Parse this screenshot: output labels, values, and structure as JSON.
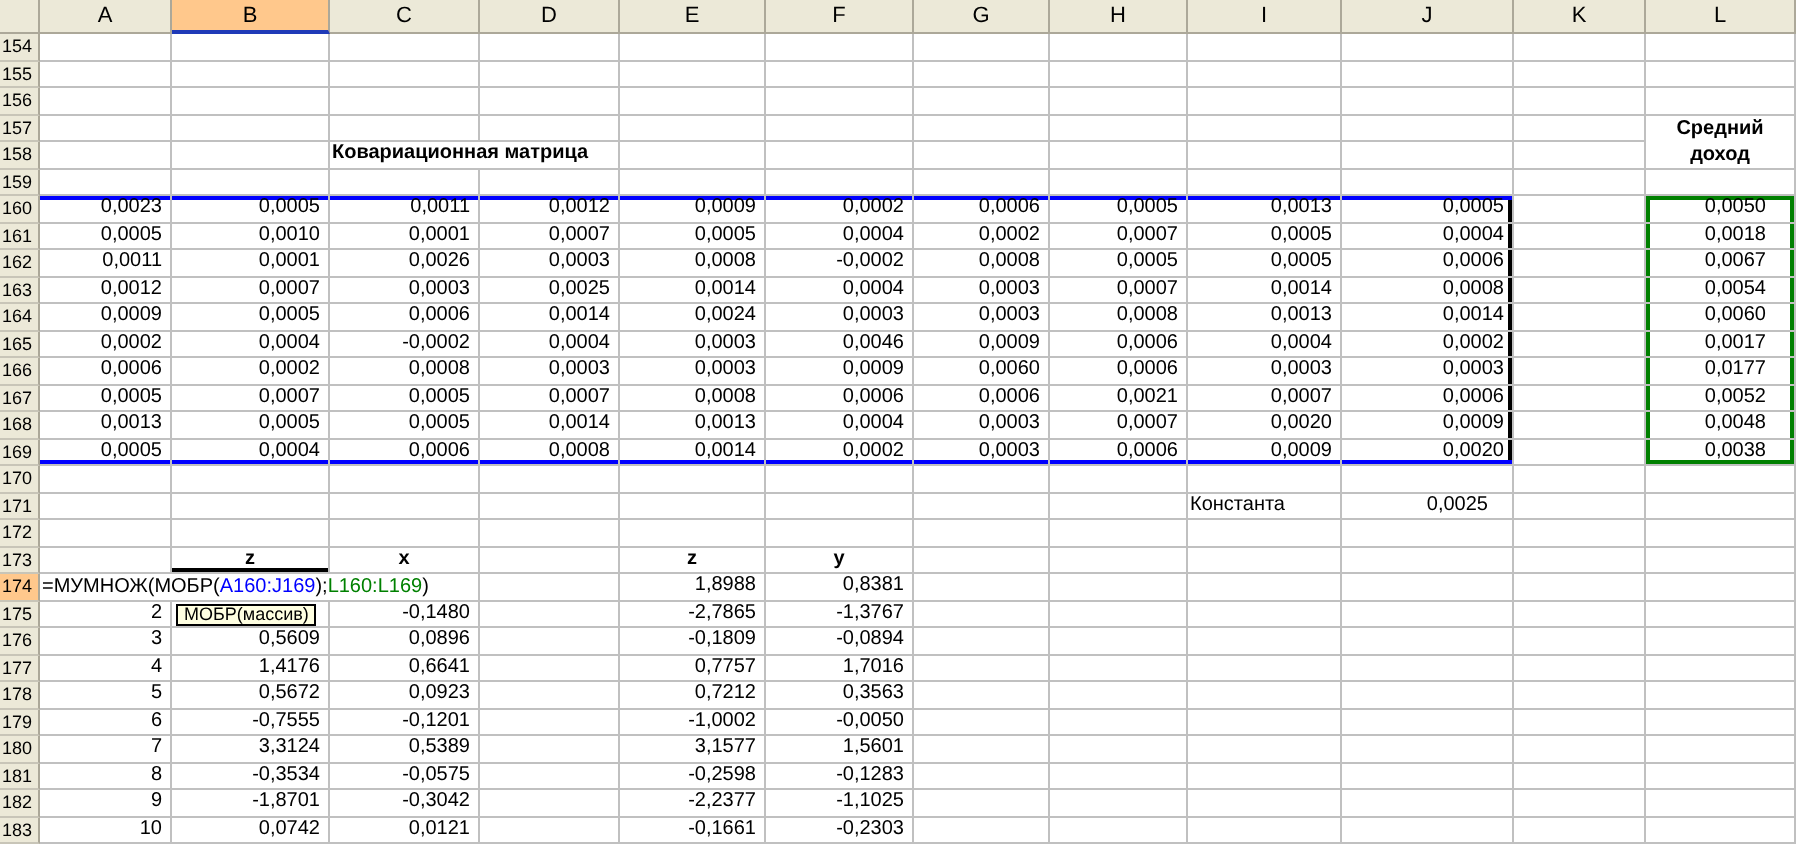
{
  "columns": [
    {
      "label": "A",
      "selected": false
    },
    {
      "label": "B",
      "selected": true
    },
    {
      "label": "C",
      "selected": false
    },
    {
      "label": "D",
      "selected": false
    },
    {
      "label": "E",
      "selected": false
    },
    {
      "label": "F",
      "selected": false
    },
    {
      "label": "G",
      "selected": false
    },
    {
      "label": "H",
      "selected": false
    },
    {
      "label": "I",
      "selected": false
    },
    {
      "label": "J",
      "selected": false
    },
    {
      "label": "K",
      "selected": false
    },
    {
      "label": "L",
      "selected": false
    }
  ],
  "rows": [
    {
      "number": "154",
      "selected": false
    },
    {
      "number": "155",
      "selected": false
    },
    {
      "number": "156",
      "selected": false
    },
    {
      "number": "157",
      "selected": false
    },
    {
      "number": "158",
      "selected": false
    },
    {
      "number": "159",
      "selected": false
    },
    {
      "number": "160",
      "selected": false
    },
    {
      "number": "161",
      "selected": false
    },
    {
      "number": "162",
      "selected": false
    },
    {
      "number": "163",
      "selected": false
    },
    {
      "number": "164",
      "selected": false
    },
    {
      "number": "165",
      "selected": false
    },
    {
      "number": "166",
      "selected": false
    },
    {
      "number": "167",
      "selected": false
    },
    {
      "number": "168",
      "selected": false
    },
    {
      "number": "169",
      "selected": false
    },
    {
      "number": "170",
      "selected": false
    },
    {
      "number": "171",
      "selected": false
    },
    {
      "number": "172",
      "selected": false
    },
    {
      "number": "173",
      "selected": false
    },
    {
      "number": "174",
      "selected": true
    },
    {
      "number": "175",
      "selected": false
    },
    {
      "number": "176",
      "selected": false
    },
    {
      "number": "177",
      "selected": false
    },
    {
      "number": "178",
      "selected": false
    },
    {
      "number": "179",
      "selected": false
    },
    {
      "number": "180",
      "selected": false
    },
    {
      "number": "181",
      "selected": false
    },
    {
      "number": "182",
      "selected": false
    },
    {
      "number": "183",
      "selected": false
    }
  ],
  "matrix_title": "Ковариационная матрица",
  "matrix": [
    [
      "0,0023",
      "0,0005",
      "0,0011",
      "0,0012",
      "0,0009",
      "0,0002",
      "0,0006",
      "0,0005",
      "0,0013",
      "0,0005"
    ],
    [
      "0,0005",
      "0,0010",
      "0,0001",
      "0,0007",
      "0,0005",
      "0,0004",
      "0,0002",
      "0,0007",
      "0,0005",
      "0,0004"
    ],
    [
      "0,0011",
      "0,0001",
      "0,0026",
      "0,0003",
      "0,0008",
      "-0,0002",
      "0,0008",
      "0,0005",
      "0,0005",
      "0,0006"
    ],
    [
      "0,0012",
      "0,0007",
      "0,0003",
      "0,0025",
      "0,0014",
      "0,0004",
      "0,0003",
      "0,0007",
      "0,0014",
      "0,0008"
    ],
    [
      "0,0009",
      "0,0005",
      "0,0006",
      "0,0014",
      "0,0024",
      "0,0003",
      "0,0003",
      "0,0008",
      "0,0013",
      "0,0014"
    ],
    [
      "0,0002",
      "0,0004",
      "-0,0002",
      "0,0004",
      "0,0003",
      "0,0046",
      "0,0009",
      "0,0006",
      "0,0004",
      "0,0002"
    ],
    [
      "0,0006",
      "0,0002",
      "0,0008",
      "0,0003",
      "0,0003",
      "0,0009",
      "0,0060",
      "0,0006",
      "0,0003",
      "0,0003"
    ],
    [
      "0,0005",
      "0,0007",
      "0,0005",
      "0,0007",
      "0,0008",
      "0,0006",
      "0,0006",
      "0,0021",
      "0,0007",
      "0,0006"
    ],
    [
      "0,0013",
      "0,0005",
      "0,0005",
      "0,0014",
      "0,0013",
      "0,0004",
      "0,0003",
      "0,0007",
      "0,0020",
      "0,0009"
    ],
    [
      "0,0005",
      "0,0004",
      "0,0006",
      "0,0008",
      "0,0014",
      "0,0002",
      "0,0003",
      "0,0006",
      "0,0009",
      "0,0020"
    ]
  ],
  "mean_income": {
    "header": "Средний доход",
    "values": [
      "0,0050",
      "0,0018",
      "0,0067",
      "0,0054",
      "0,0060",
      "0,0017",
      "0,0177",
      "0,0052",
      "0,0048",
      "0,0038"
    ]
  },
  "constant": {
    "label": "Константа",
    "value": "0,0025"
  },
  "results": {
    "headers": [
      "z",
      "x",
      "z",
      "y"
    ],
    "formula": [
      {
        "text": "=МУМНОЖ(МОБР(",
        "color": "#000000"
      },
      {
        "text": "A160:J169",
        "color": "#0000ff"
      },
      {
        "text": ");",
        "color": "#000000"
      },
      {
        "text": "L160:L169",
        "color": "#008000"
      },
      {
        "text": ")",
        "color": "#000000"
      }
    ],
    "formula_values": [
      "1,8988",
      "0,8381"
    ],
    "tooltip": "МОБР(массив)",
    "rows": [
      {
        "a": "2",
        "c": "-0,1480",
        "e": "-2,7865",
        "f": "-1,3767"
      },
      {
        "a": "3",
        "b": "0,5609",
        "c": "0,0896",
        "e": "-0,1809",
        "f": "-0,0894"
      },
      {
        "a": "4",
        "b": "1,4176",
        "c": "0,6641",
        "e": "0,7757",
        "f": "1,7016"
      },
      {
        "a": "5",
        "b": "0,5672",
        "c": "0,0923",
        "e": "0,7212",
        "f": "0,3563"
      },
      {
        "a": "6",
        "b": "-0,7555",
        "c": "-0,1201",
        "e": "-1,0002",
        "f": "-0,0050"
      },
      {
        "a": "7",
        "b": "3,3124",
        "c": "0,5389",
        "e": "3,1577",
        "f": "1,5601"
      },
      {
        "a": "8",
        "b": "-0,3534",
        "c": "-0,0575",
        "e": "-0,2598",
        "f": "-0,1283"
      },
      {
        "a": "9",
        "b": "-1,8701",
        "c": "-0,3042",
        "e": "-2,2377",
        "f": "-1,1025"
      },
      {
        "a": "10",
        "b": "0,0742",
        "c": "0,0121",
        "e": "-0,1661",
        "f": "-0,2303"
      }
    ]
  }
}
